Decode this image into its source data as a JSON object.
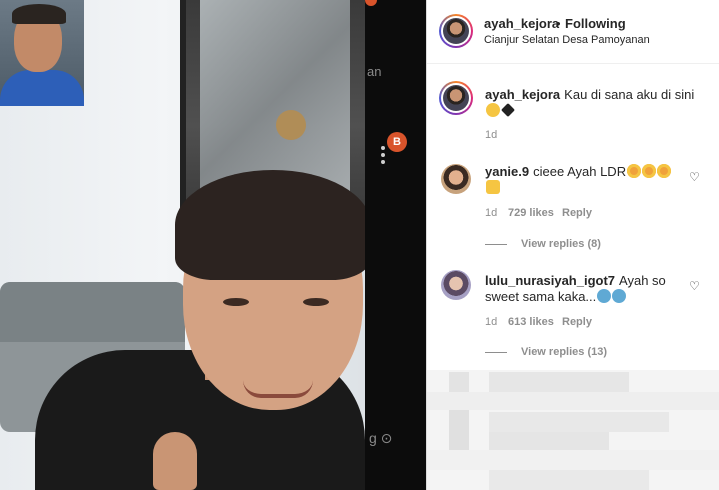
{
  "media": {
    "overlay_hint": "an",
    "badge": "B",
    "location_glyph": "g"
  },
  "post": {
    "username": "ayah_kejora",
    "separator": "•",
    "follow_label": "Following",
    "location": "Cianjur Selatan Desa Pamoyanan"
  },
  "caption": {
    "username": "ayah_kejora",
    "text": "Kau di sana aku di sini",
    "age": "1d"
  },
  "comments": [
    {
      "username": "yanie.9",
      "text": "cieee Ayah LDR",
      "age": "1d",
      "likes": "729 likes",
      "reply_label": "Reply",
      "view_replies": "View replies (8)"
    },
    {
      "username": "lulu_nurasiyah_igot7",
      "text": "Ayah so sweet sama kaka...",
      "age": "1d",
      "likes": "613 likes",
      "reply_label": "Reply",
      "view_replies": "View replies (13)"
    }
  ],
  "icons": {
    "heart": "heart-outline-icon",
    "location": "location-pin-icon",
    "more": "more-vertical-icon"
  },
  "colors": {
    "text": "#262626",
    "muted": "#8e8e8e",
    "accent_badge": "#d9542b"
  }
}
